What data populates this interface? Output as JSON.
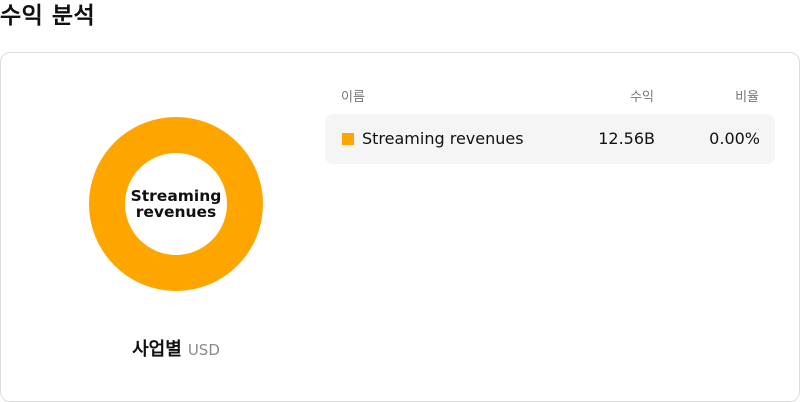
{
  "header": {
    "title": "수익 분석"
  },
  "chart": {
    "center_label": "Streaming revenues",
    "caption": "사업별",
    "currency": "USD",
    "slice_color": "#ffa500"
  },
  "table": {
    "columns": {
      "name": "이름",
      "revenue": "수익",
      "percent": "비율"
    },
    "rows": [
      {
        "name": "Streaming revenues",
        "revenue": "12.56B",
        "percent": "0.00%",
        "color": "#ffa500"
      }
    ]
  },
  "chart_data": {
    "type": "pie",
    "categories": [
      "Streaming revenues"
    ],
    "values": [
      12.56
    ],
    "unit": "B USD",
    "legend": "right-table"
  }
}
